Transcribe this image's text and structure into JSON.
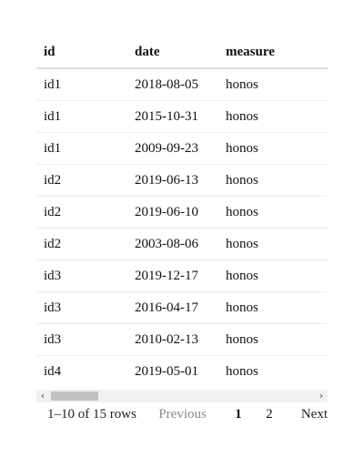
{
  "table": {
    "columns": [
      "id",
      "date",
      "measure"
    ],
    "rows": [
      [
        "id1",
        "2018-08-05",
        "honos"
      ],
      [
        "id1",
        "2015-10-31",
        "honos"
      ],
      [
        "id1",
        "2009-09-23",
        "honos"
      ],
      [
        "id2",
        "2019-06-13",
        "honos"
      ],
      [
        "id2",
        "2019-06-10",
        "honos"
      ],
      [
        "id2",
        "2003-08-06",
        "honos"
      ],
      [
        "id3",
        "2019-12-17",
        "honos"
      ],
      [
        "id3",
        "2016-04-17",
        "honos"
      ],
      [
        "id3",
        "2010-02-13",
        "honos"
      ],
      [
        "id4",
        "2019-05-01",
        "honos"
      ]
    ]
  },
  "scrollbar": {
    "left_icon": "chevron-left-icon",
    "right_icon": "chevron-right-icon",
    "left_glyph": "‹",
    "right_glyph": "›"
  },
  "footer": {
    "info": "1–10 of 15 rows",
    "previous_label": "Previous",
    "pages": [
      "1",
      "2"
    ],
    "current_page": "1",
    "next_label": "Next"
  }
}
